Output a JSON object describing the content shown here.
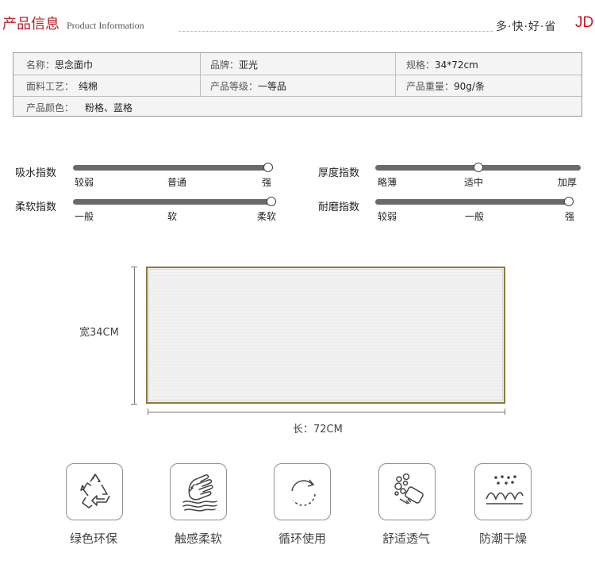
{
  "header": {
    "title_cn": "产品信息",
    "title_en": "Product Information",
    "slogan": "多·快·好·省",
    "brand_mark": "JD"
  },
  "specs": {
    "name_label": "名称：",
    "name_value": "思念面巾",
    "brand_label": "品牌：",
    "brand_value": "亚光",
    "size_label": "规格：",
    "size_value": "34*72cm",
    "fabric_label": "面料工艺：",
    "fabric_value": "纯棉",
    "grade_label": "产品等级：",
    "grade_value": "一等品",
    "weight_label": "产品重量：",
    "weight_value": "90g/条",
    "color_label": "产品颜色：",
    "color_value": "粉格、蓝格"
  },
  "indices": {
    "absorbency": {
      "label": "吸水指数",
      "ticks": [
        "较弱",
        "普通",
        "强"
      ],
      "level": 1.0
    },
    "softness": {
      "label": "柔软指数",
      "ticks": [
        "一般",
        "软",
        "柔软"
      ],
      "level": 1.0
    },
    "thickness": {
      "label": "厚度指数",
      "ticks": [
        "略薄",
        "适中",
        "加厚"
      ],
      "level": 0.5
    },
    "durability": {
      "label": "耐磨指数",
      "ticks": [
        "较弱",
        "一般",
        "强"
      ],
      "level": 1.0
    }
  },
  "diagram": {
    "width_label": "宽34CM",
    "length_label": "长：72CM",
    "frame_color": "#8e7a3d"
  },
  "features": [
    {
      "label": "绿色环保",
      "icon": "recycle-icon"
    },
    {
      "label": "触感柔软",
      "icon": "hand-touch-icon"
    },
    {
      "label": "循环使用",
      "icon": "cycle-arrow-icon"
    },
    {
      "label": "舒适透气",
      "icon": "bubbles-soap-icon"
    },
    {
      "label": "防潮干燥",
      "icon": "moisture-wave-icon"
    }
  ],
  "colors": {
    "accent_red": "#b5202a",
    "jd_red": "#c81623",
    "slider_track": "#6a6a6a"
  }
}
